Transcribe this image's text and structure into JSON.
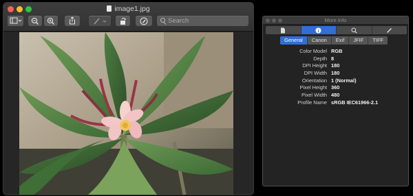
{
  "preview": {
    "title": "image1.jpg",
    "search": {
      "placeholder": "Search"
    },
    "toolbar": [
      {
        "name": "sidebar-toggle-button",
        "icon": "sidebar-icon"
      },
      {
        "name": "zoom-out-button",
        "icon": "zoom-out-icon"
      },
      {
        "name": "zoom-in-button",
        "icon": "zoom-in-icon"
      },
      {
        "name": "share-button",
        "icon": "share-icon"
      },
      {
        "name": "markup-pen-button",
        "icon": "pen-icon"
      },
      {
        "name": "rotate-button",
        "icon": "rotate-icon"
      },
      {
        "name": "markup-toolbar-button",
        "icon": "markup-icon"
      }
    ],
    "image": {
      "subject": "frangipani-flower-photo"
    }
  },
  "info_panel": {
    "title": "More Info",
    "top_tabs": [
      {
        "icon": "document-icon",
        "active": false
      },
      {
        "icon": "info-icon",
        "active": true
      },
      {
        "icon": "magnifier-icon",
        "active": false
      },
      {
        "icon": "pencil-icon",
        "active": false
      }
    ],
    "subtabs": [
      {
        "label": "General",
        "active": true
      },
      {
        "label": "Canon",
        "active": false
      },
      {
        "label": "Exif",
        "active": false
      },
      {
        "label": "JFIF",
        "active": false
      },
      {
        "label": "TIFF",
        "active": false
      }
    ],
    "properties": [
      {
        "key": "Color Model",
        "value": "RGB"
      },
      {
        "key": "Depth",
        "value": "8"
      },
      {
        "key": "DPI Height",
        "value": "180"
      },
      {
        "key": "DPI Width",
        "value": "180"
      },
      {
        "key": "Orientation",
        "value": "1 (Normal)"
      },
      {
        "key": "Pixel Height",
        "value": "360"
      },
      {
        "key": "Pixel Width",
        "value": "480"
      },
      {
        "key": "Profile Name",
        "value": "sRGB IEC61966-2.1"
      }
    ]
  },
  "colors": {
    "accent": "#2f6fd6",
    "close": "#fc5f57",
    "minimize": "#fdbc2e",
    "maximize": "#28c840"
  }
}
